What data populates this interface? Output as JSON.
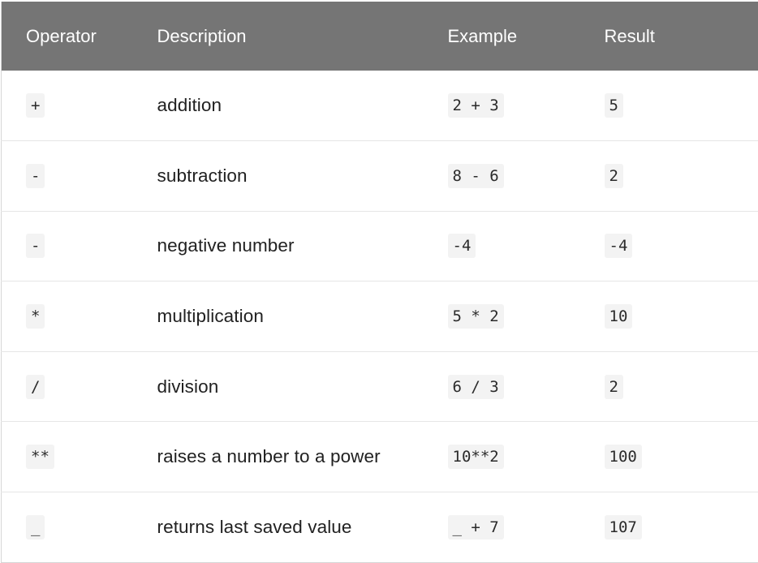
{
  "table": {
    "headers": [
      "Operator",
      "Description",
      "Example",
      "Result"
    ],
    "rows": [
      {
        "operator": "+",
        "description": "addition",
        "example": "2 + 3",
        "result": "5"
      },
      {
        "operator": "-",
        "description": "subtraction",
        "example": "8 - 6",
        "result": "2"
      },
      {
        "operator": "-",
        "description": "negative number",
        "example": "-4",
        "result": "-4"
      },
      {
        "operator": "*",
        "description": "multiplication",
        "example": "5 * 2",
        "result": "10"
      },
      {
        "operator": "/",
        "description": "division",
        "example": "6 / 3",
        "result": "2"
      },
      {
        "operator": "**",
        "description": "raises a number to a power",
        "example": "10**2",
        "result": "100"
      },
      {
        "operator": "_",
        "description": "returns last saved value",
        "example": "_ + 7",
        "result": "107"
      }
    ]
  },
  "colors": {
    "header_background": "#757575",
    "header_text": "#ffffff",
    "code_background": "#f3f3f3",
    "row_divider": "#e6e6e6"
  }
}
